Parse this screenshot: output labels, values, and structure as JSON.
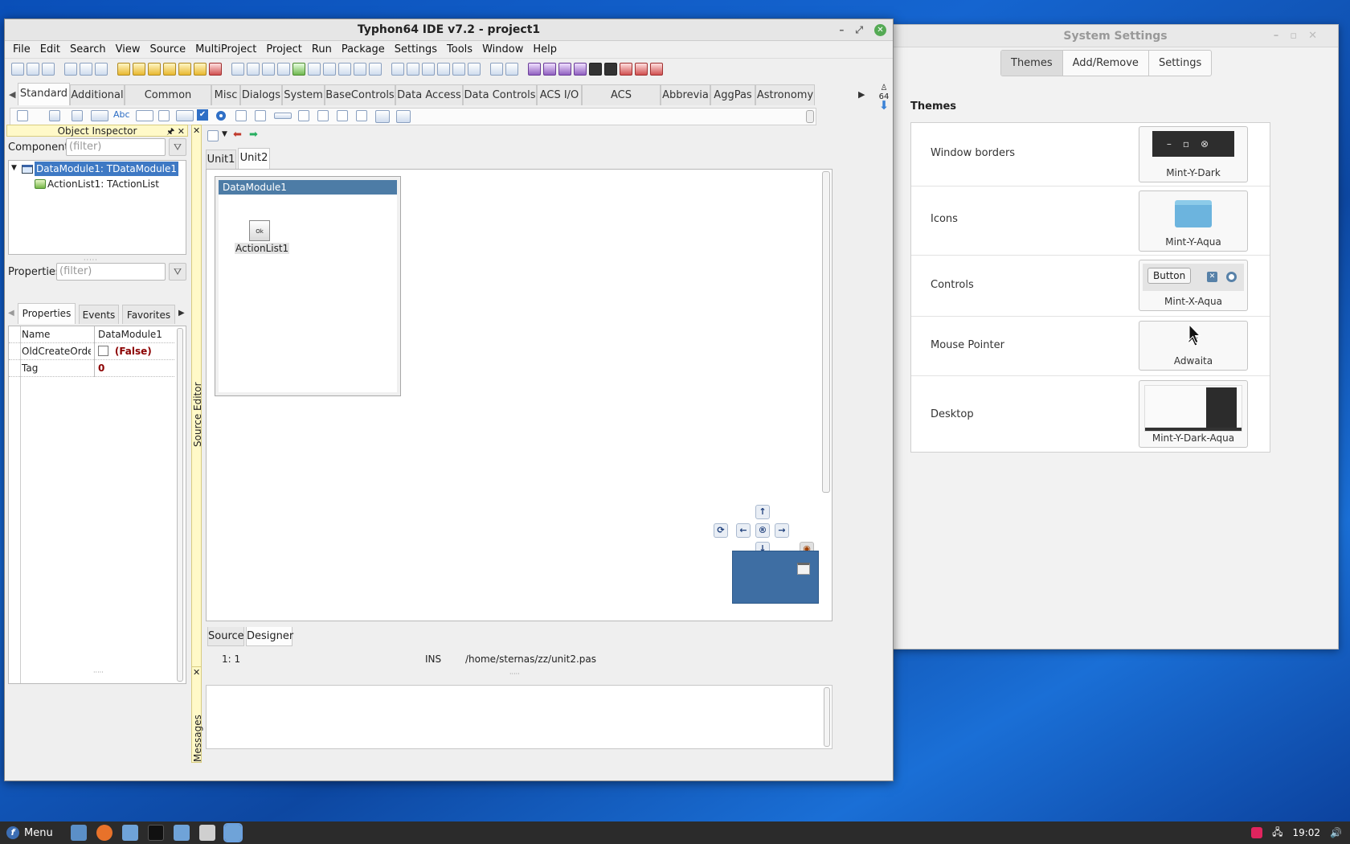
{
  "settings_window": {
    "title": "System Settings",
    "tabs": [
      "Themes",
      "Add/Remove",
      "Settings"
    ],
    "active_tab": "Themes",
    "heading": "Themes",
    "rows": [
      {
        "label": "Window borders",
        "value": "Mint-Y-Dark"
      },
      {
        "label": "Icons",
        "value": "Mint-Y-Aqua"
      },
      {
        "label": "Controls",
        "value": "Mint-X-Aqua",
        "preview_button": "Button"
      },
      {
        "label": "Mouse Pointer",
        "value": "Adwaita"
      },
      {
        "label": "Desktop",
        "value": "Mint-Y-Dark-Aqua"
      }
    ]
  },
  "ide": {
    "title": "Typhon64 IDE v7.2 - project1",
    "menu": [
      "File",
      "Edit",
      "Search",
      "View",
      "Source",
      "MultiProject",
      "Project",
      "Run",
      "Package",
      "Settings",
      "Tools",
      "Window",
      "Help"
    ],
    "palette_tabs": [
      "Standard",
      "Additional",
      "Common Controls",
      "Misc",
      "Dialogs",
      "System",
      "BaseControls",
      "Data Access",
      "Data Controls",
      "ACS I/O",
      "ACS Processing",
      "Abbrevia",
      "AggPas",
      "Astronomy"
    ],
    "palette_active": "Standard",
    "palette_counter": "64",
    "object_inspector": {
      "title": "Object Inspector",
      "components_label": "Components",
      "components_filter_placeholder": "(filter)",
      "tree": [
        {
          "label": "DataModule1: TDataModule1",
          "selected": true
        },
        {
          "label": "ActionList1: TActionList",
          "selected": false
        }
      ],
      "properties_label": "Properties",
      "properties_filter_placeholder": "(filter)",
      "tabs": [
        "Properties",
        "Events",
        "Favorites"
      ],
      "grid": [
        {
          "name": "Name",
          "value": "DataModule1"
        },
        {
          "name": "OldCreateOrder",
          "value": "(False)"
        },
        {
          "name": "Tag",
          "value": "0"
        }
      ]
    },
    "editor": {
      "side_label": "Source Editor",
      "tabs": [
        "Unit1",
        "Unit2"
      ],
      "active_tab": "Unit2",
      "datamodule_title": "DataModule1",
      "component_label": "ActionList1",
      "bottom_tabs": [
        "Source",
        "Designer"
      ],
      "bottom_active": "Designer",
      "status_pos": "1:  1",
      "status_mode": "INS",
      "status_file": "/home/sternas/zz/unit2.pas",
      "messages_label": "Messages"
    }
  },
  "taskbar": {
    "menu_label": "Menu",
    "clock": "19:02"
  }
}
